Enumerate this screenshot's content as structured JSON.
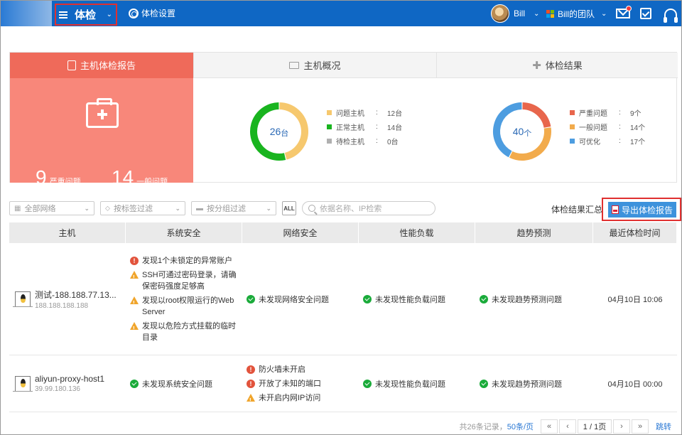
{
  "topbar": {
    "product_title": "体检",
    "settings_label": "体检设置",
    "user_name": "Bill",
    "team_name": "Bill的团队"
  },
  "tabs": {
    "report": "主机体检报告",
    "overview": "主机概况",
    "results": "体检结果"
  },
  "report_card": {
    "severe_count": "9",
    "severe_label": "严重问题",
    "general_count": "14",
    "general_label": "一般问题"
  },
  "overview_card": {
    "total": "26",
    "total_unit": "台",
    "legend": [
      {
        "label": "问题主机",
        "sep": ":",
        "value": "12台",
        "count": 12,
        "color": "#f6c86e"
      },
      {
        "label": "正常主机",
        "sep": ":",
        "value": "14台",
        "count": 14,
        "color": "#19b41f"
      },
      {
        "label": "待检主机",
        "sep": ":",
        "value": "0台",
        "count": 0,
        "color": "#b0b0b0"
      }
    ]
  },
  "results_card": {
    "total": "40",
    "total_unit": "个",
    "legend": [
      {
        "label": "严重问题",
        "sep": ":",
        "value": "9个",
        "count": 9,
        "color": "#e8664c"
      },
      {
        "label": "一般问题",
        "sep": ":",
        "value": "14个",
        "count": 14,
        "color": "#f2ab4c"
      },
      {
        "label": "可优化",
        "sep": ":",
        "value": "17个",
        "count": 17,
        "color": "#4d9de0"
      }
    ]
  },
  "filters": {
    "network": "全部网络",
    "tag": "按标签过滤",
    "group": "按分组过滤",
    "all": "ALL",
    "search_placeholder": "依据名称、IP检索",
    "summary": "体检结果汇总",
    "export": "导出体检报告"
  },
  "table": {
    "headers": [
      "主机",
      "系统安全",
      "网络安全",
      "性能负载",
      "趋势预测",
      "最近体检时间"
    ],
    "rows": [
      {
        "name": "测试-188.188.77.13...",
        "ip": "188.188.188.188",
        "system": [
          {
            "level": "err",
            "text": "发现1个未锁定的异常账户"
          },
          {
            "level": "warn",
            "text": "SSH可通过密码登录，请确保密码强度足够高"
          },
          {
            "level": "warn",
            "text": "发现以root权限运行的Web Server"
          },
          {
            "level": "warn",
            "text": "发现以危险方式挂载的临时目录"
          }
        ],
        "network": [
          {
            "level": "ok",
            "text": "未发现网络安全问题"
          }
        ],
        "performance": "未发现性能负载问题",
        "trend": "未发现趋势预测问题",
        "time": "04月10日 10:06"
      },
      {
        "name": "aliyun-proxy-host1",
        "ip": "39.99.180.136",
        "system": [
          {
            "level": "ok",
            "text": "未发现系统安全问题"
          }
        ],
        "network": [
          {
            "level": "err",
            "text": "防火墙未开启"
          },
          {
            "level": "err",
            "text": "开放了未知的端口"
          },
          {
            "level": "warn",
            "text": "未开启内网IP访问"
          }
        ],
        "performance": "未发现性能负载问题",
        "trend": "未发现趋势预测问题",
        "time": "04月10日 00:00"
      }
    ]
  },
  "pagination": {
    "total": "共26条记录，",
    "per_page": "50条/页",
    "first": "«",
    "prev": "‹",
    "current": "1 / 1页",
    "next": "›",
    "last": "»",
    "jump": "跳转"
  },
  "icons": {
    "menu": "menu-icon",
    "settings": "gear-icon",
    "mail": "mail-icon",
    "task": "task-check-icon",
    "support": "headset-icon",
    "report_tab": "report-icon",
    "overview_tab": "monitor-icon",
    "results_tab": "cross-icon"
  }
}
